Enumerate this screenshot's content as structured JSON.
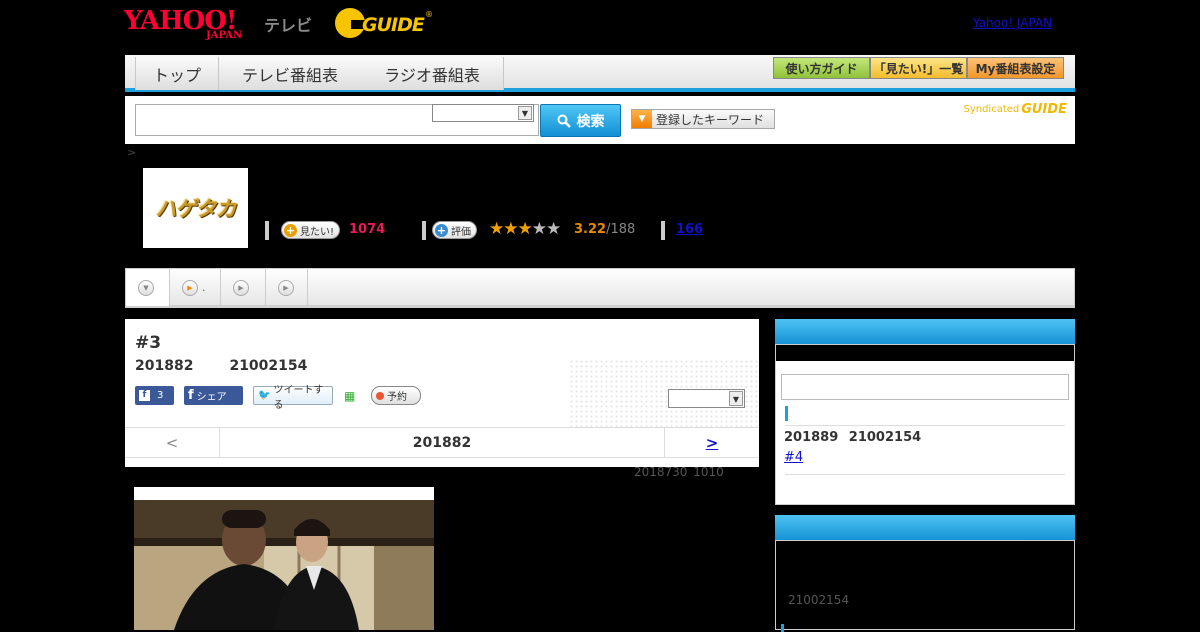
{
  "header": {
    "brand_yahoo": "YAHOO!",
    "brand_japan": "JAPAN",
    "brand_tv": "テレビ",
    "gguide_text": "GUIDE",
    "yahoo_japan_link": "Yahoo! JAPAN"
  },
  "nav": {
    "tabs": [
      "トップ",
      "テレビ番組表",
      "ラジオ番組表"
    ],
    "buttons": [
      {
        "label": "使い方ガイド",
        "color": "#9ccc3a"
      },
      {
        "label": "「見たい!」一覧",
        "color": "#f6c63a"
      },
      {
        "label": "My番組表設定",
        "color": "#f6a23a"
      }
    ]
  },
  "search": {
    "button_label": "検索",
    "keyword_label": "登録したキーワード",
    "syndicated_label": "Syndicated",
    "syndicated_logo": "GUIDE"
  },
  "breadcrumb": ">",
  "program": {
    "logo_text": "ハゲタカ",
    "watch_label": "見たい!",
    "watch_count": "1074",
    "rating_label": "評価",
    "rating_stars": 3,
    "rating_score": "3.22",
    "rating_total": "/188",
    "review_count": "166"
  },
  "tabs": [
    {
      "label": "",
      "icon": "chevron-down-icon"
    },
    {
      "label": ".",
      "icon": "play-icon"
    },
    {
      "label": "",
      "icon": "play-icon"
    },
    {
      "label": "",
      "icon": "play-icon"
    }
  ],
  "episode": {
    "number": "#3",
    "date": "201882",
    "time": "21002154",
    "fb_count": "3",
    "fb_share_label": "シェア",
    "tweet_label": "ツイートする",
    "reserve_label": "予約",
    "nav_prev": "<",
    "nav_current": "201882",
    "nav_next": ">",
    "air_info": "2018730  1010"
  },
  "sidebar": {
    "next_episode_datetime": "201889  21002154",
    "next_episode_link": "#4",
    "box2_time": "21002154"
  },
  "colors": {
    "accent_blue": "#1ea0dc",
    "watch_pink": "#e81c5a",
    "rating_orange": "#e88a00"
  }
}
